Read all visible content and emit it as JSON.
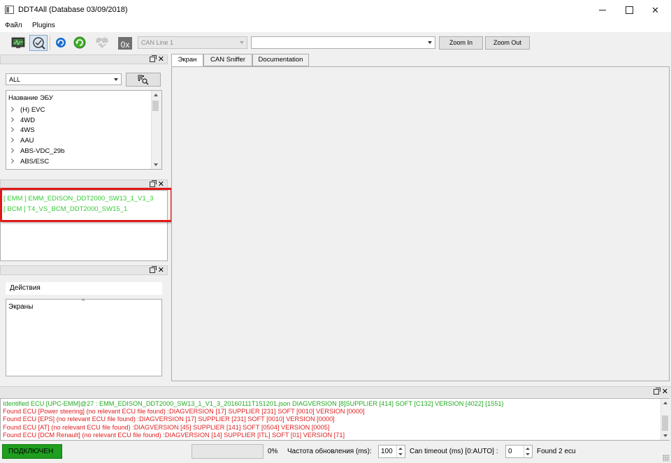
{
  "window": {
    "title": "DDT4All (Database 03/09/2018)"
  },
  "menu": {
    "items": [
      {
        "label": "Файл"
      },
      {
        "label": "Plugins"
      }
    ]
  },
  "toolbar": {
    "icons": [
      "connect-monitor-icon",
      "scan-ecu-icon",
      "refresh-icon",
      "reconnect-icon",
      "heart-monitor-icon",
      "hex-icon"
    ],
    "hex_label": "0x",
    "can_line_value": "CAN Line 1",
    "screen_select_value": "",
    "zoom_in_label": "Zoom In",
    "zoom_out_label": "Zoom Out"
  },
  "ecu_panel": {
    "filter_value": "ALL",
    "tree_header": "Название ЭБУ",
    "tree_items": [
      {
        "label": "(H) EVC"
      },
      {
        "label": "4WD"
      },
      {
        "label": "4WS"
      },
      {
        "label": "AAU"
      },
      {
        "label": "ABS-VDC_29b"
      },
      {
        "label": "ABS/ESC"
      }
    ]
  },
  "found_panel": {
    "items": [
      {
        "label": "[ EMM ] EMM_EDISON_DDT2000_SW13_1_V1_3"
      },
      {
        "label": "[ BCM ] T4_VS_BCM_DDT2000_SW15_1"
      }
    ]
  },
  "actions_panel": {
    "header": "Действия",
    "screens_label": "Экраны"
  },
  "tabs": [
    {
      "label": "Экран",
      "selected": true
    },
    {
      "label": "CAN Sniffer",
      "selected": false
    },
    {
      "label": "Documentation",
      "selected": false
    }
  ],
  "log": {
    "lines": [
      {
        "text": "Identified ECU [UPC-EMM]@27 : EMM_EDISON_DDT2000_SW13_1_V1_3_20160111T151201.json DIAGVERSION [8]SUPPLIER [414] SOFT [C132] VERSION [4022] {1551}",
        "level": "ok"
      },
      {
        "text": "Found ECU [Power steering] (no relevant ECU file found) :DIAGVERSION [17] SUPPLIER [231] SOFT [0010] VERSION [0000]",
        "level": "err"
      },
      {
        "text": "Found ECU [EPS] (no relevant ECU file found) :DIAGVERSION [17] SUPPLIER [231] SOFT [0010] VERSION [0000]",
        "level": "err"
      },
      {
        "text": "Found ECU [AT] (no relevant ECU file found) :DIAGVERSION [45] SUPPLIER [141] SOFT [0504] VERSION [0005]",
        "level": "err"
      },
      {
        "text": "Found ECU [DCM Renault] (no relevant ECU file found) :DIAGVERSION [14] SUPPLIER [ITL] SOFT [01] VERSION [71]",
        "level": "err"
      }
    ]
  },
  "status": {
    "connection": "ПОДКЛЮЧЕН",
    "progress_percent": 0,
    "progress_text": "0%",
    "refresh_label": "Частота обновления (ms):",
    "refresh_value": "100",
    "timeout_label": "Can timeout (ms) [0:AUTO] :",
    "timeout_value": "0",
    "found_text": "Found 2 ecu"
  },
  "colors": {
    "found_ecu": "#33cc33",
    "log_ok": "#22aa22",
    "log_err": "#e02020",
    "connected": "#1f9e1f",
    "highlight": "#e01818"
  }
}
